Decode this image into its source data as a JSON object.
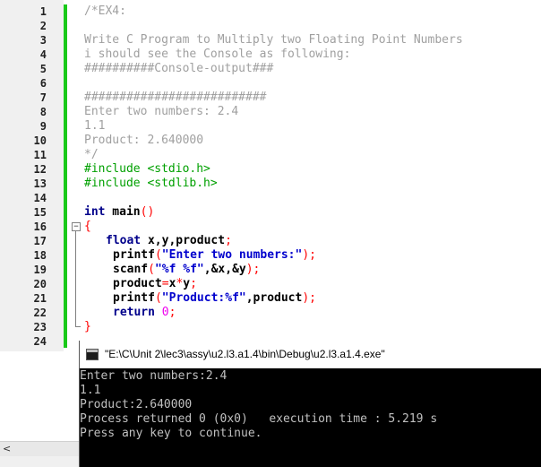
{
  "editor": {
    "line_numbers": [
      "1",
      "2",
      "3",
      "4",
      "5",
      "6",
      "7",
      "8",
      "9",
      "10",
      "11",
      "12",
      "13",
      "14",
      "15",
      "16",
      "17",
      "18",
      "19",
      "20",
      "21",
      "22",
      "23",
      "24"
    ],
    "code": {
      "l1": "/*EX4:",
      "l3": "Write C Program to Multiply two Floating Point Numbers",
      "l4": "i should see the Console as following:",
      "l5": "##########Console-output###",
      "l7": "##########################",
      "l8": "Enter two numbers: 2.4",
      "l9": "1.1",
      "l10": "Product: 2.640000",
      "l11": "*/",
      "l12": "#include <stdio.h>",
      "l13": "#include <stdlib.h>",
      "l15_kw": "int",
      "l15_rest": " main",
      "l15_paren": "()",
      "l16": "{",
      "l17_kw": "float",
      "l17_rest": " x,y,product",
      "l17_semi": ";",
      "l18_fn": "printf",
      "l18_str": "\"Enter two numbers:\"",
      "l19_fn": "scanf",
      "l19_str": "\"%f %f\"",
      "l19_rest": ",&x,&y",
      "l20_a": "product",
      "l20_b": "x",
      "l20_c": "y",
      "l21_fn": "printf",
      "l21_str": "\"Product:%f\"",
      "l21_rest": ",product",
      "l22_kw": "return",
      "l22_num": "0",
      "l23": "}"
    },
    "fold_marker": "−"
  },
  "console": {
    "title": "\"E:\\C\\Unit 2\\lec3\\assy\\u2.l3.a1.4\\bin\\Debug\\u2.l3.a1.4.exe\"",
    "lines": [
      "Enter two numbers:2.4",
      "1.1",
      "Product:2.640000",
      "Process returned 0 (0x0)   execution time : 5.219 s",
      "Press any key to continue."
    ]
  },
  "scrollbar": {
    "left_arrow": "<"
  },
  "colors": {
    "comment": "#a0a0a0",
    "preprocessor": "#00a000",
    "keyword": "#00008b",
    "string": "#0000cd",
    "number": "#ee00ee",
    "change_bar": "#19c919",
    "console_bg": "#000000",
    "console_text": "#c0c0c0"
  }
}
